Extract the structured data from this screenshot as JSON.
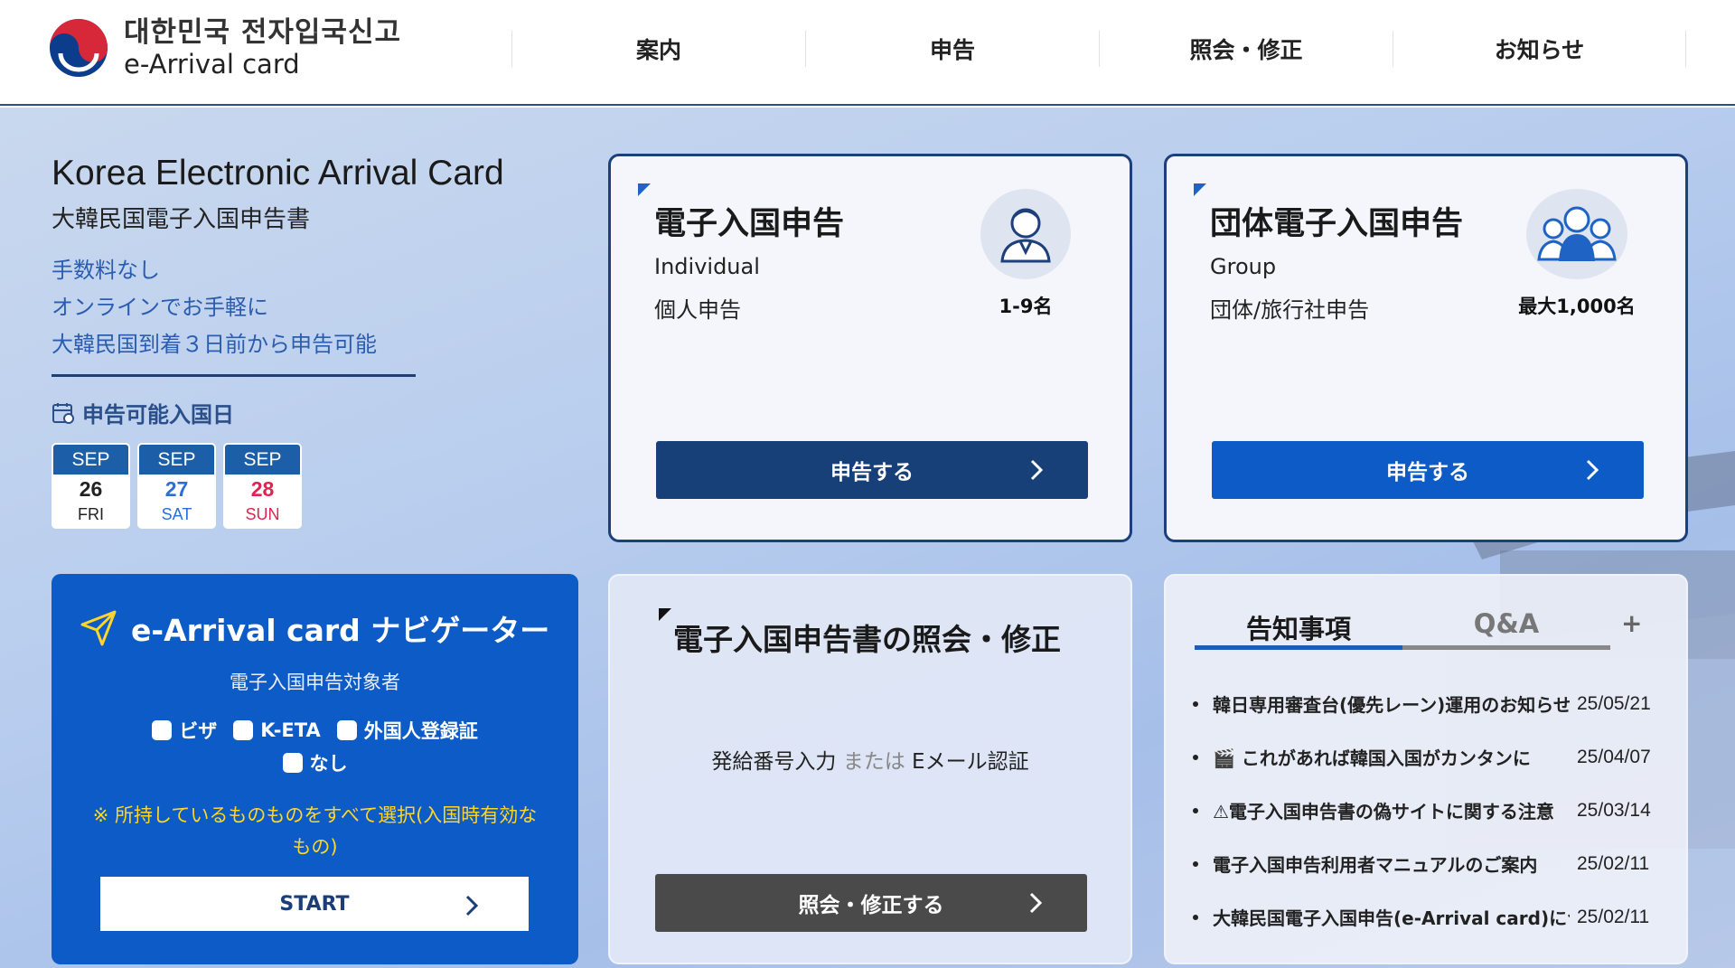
{
  "header": {
    "logo_ko": "대한민국 전자입국신고",
    "logo_en": "e-Arrival card",
    "nav": [
      "案内",
      "申告",
      "照会・修正",
      "お知らせ"
    ]
  },
  "intro": {
    "title": "Korea Electronic Arrival Card",
    "subtitle": "大韓民国電子入国申告書",
    "benefits": [
      "手数料なし",
      "オンラインでお手軽に",
      "大韓民国到着３日前から申告可能"
    ],
    "dates_label": "申告可能入国日",
    "dates": [
      {
        "month": "SEP",
        "day": "26",
        "dow": "FRI"
      },
      {
        "month": "SEP",
        "day": "27",
        "dow": "SAT"
      },
      {
        "month": "SEP",
        "day": "28",
        "dow": "SUN"
      }
    ]
  },
  "individual": {
    "title": "電子入国申告",
    "en": "Individual",
    "ja": "個人申告",
    "caption": "1-9名",
    "button": "申告する"
  },
  "group": {
    "title": "団体電子入国申告",
    "en": "Group",
    "ja": "団体/旅行社申告",
    "caption": "最大1,000名",
    "button": "申告する"
  },
  "navigator": {
    "title": "e-Arrival card ナビゲーター",
    "subtitle": "電子入国申告対象者",
    "options": [
      "ビザ",
      "K-ETA",
      "外国人登録証",
      "なし"
    ],
    "note": "※ 所持しているものものをすべて選択(入国時有効なもの)",
    "start": "START"
  },
  "inquiry": {
    "title": "電子入国申告書の照会・修正",
    "desc_a": "発給番号入力",
    "desc_or": "または",
    "desc_b": "Eメール認証",
    "button": "照会・修正する"
  },
  "notices": {
    "tab_active": "告知事項",
    "tab_inactive": "Q&A",
    "more": "+",
    "items": [
      {
        "title": "韓日専用審査台(優先レーン)運用のお知らせ",
        "date": "25/05/21"
      },
      {
        "title": "🎬 これがあれば韓国入国がカンタンに",
        "date": "25/04/07"
      },
      {
        "title": "⚠電子入国申告書の偽サイトに関する注意",
        "date": "25/03/14"
      },
      {
        "title": "電子入国申告利用者マニュアルのご案内",
        "date": "25/02/11"
      },
      {
        "title": "大韓民国電子入国申告(e-Arrival card)について",
        "date": "25/02/11"
      }
    ]
  },
  "colors": {
    "primary_dark": "#173f78",
    "primary": "#0d5bc6",
    "inquiry_button": "#4a4a4a",
    "sat": "#2c6fd1",
    "sun": "#e02350",
    "note": "#ffd628"
  }
}
